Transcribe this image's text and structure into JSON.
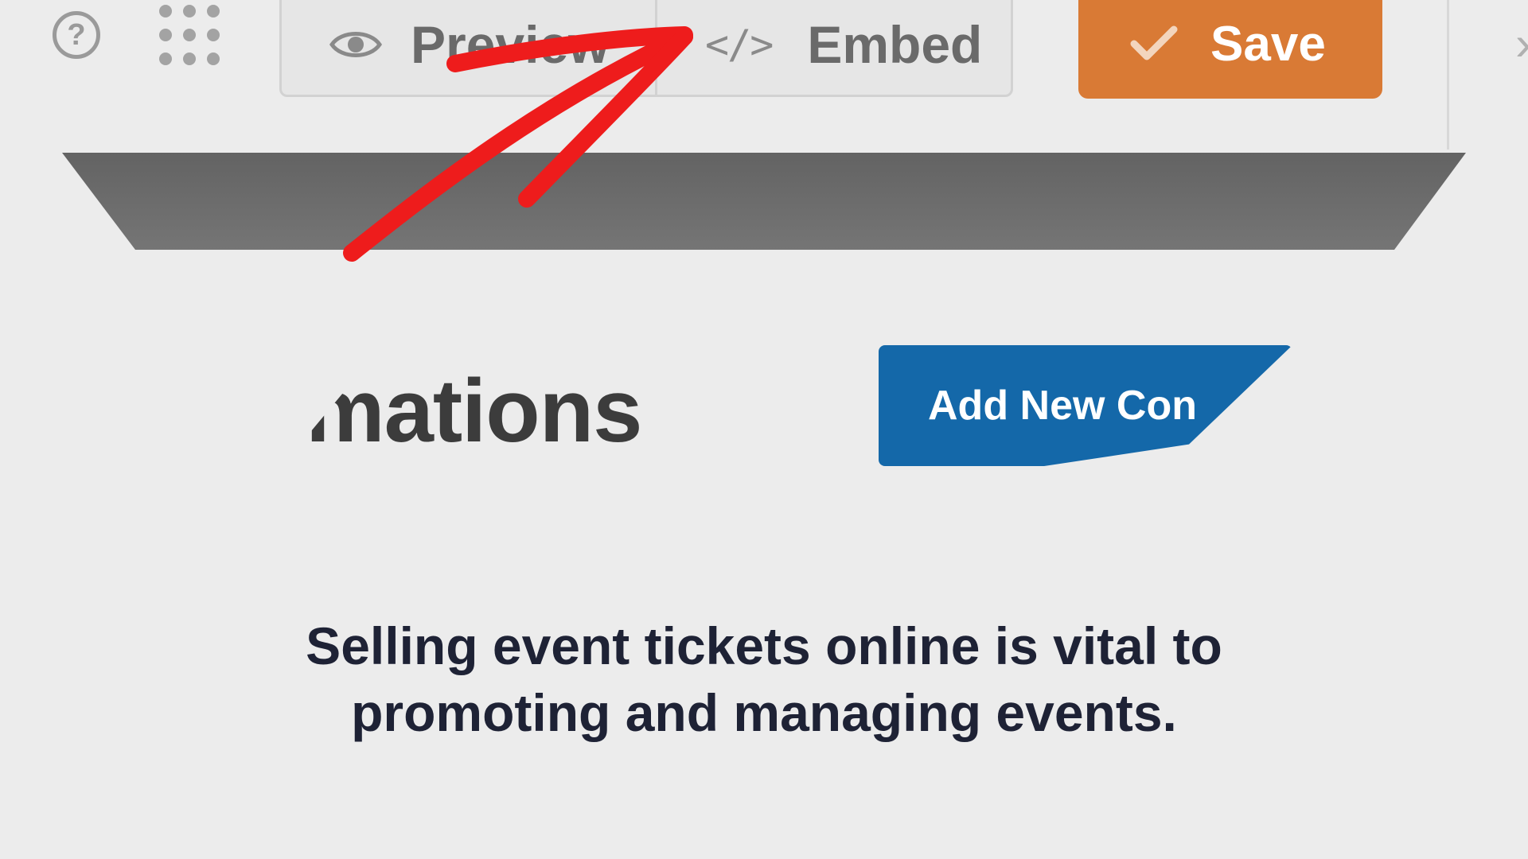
{
  "toolbar": {
    "help_icon": "question-circle-icon",
    "apps_icon": "grid-dots-icon",
    "preview_label": "Preview",
    "preview_icon": "eye-icon",
    "embed_label": "Embed",
    "embed_icon": "code-icon",
    "save_label": "Save",
    "save_icon": "check-icon",
    "accent_color": "#d97a35",
    "chevron_glyph": "›"
  },
  "main": {
    "heading_fragment": "mations",
    "add_button_label": "Add New Con",
    "add_button_color": "#1468a9"
  },
  "caption": {
    "line1": "Selling event tickets online is vital to",
    "line2": "promoting and managing events."
  },
  "annotation": {
    "color": "#ee1c1c"
  }
}
